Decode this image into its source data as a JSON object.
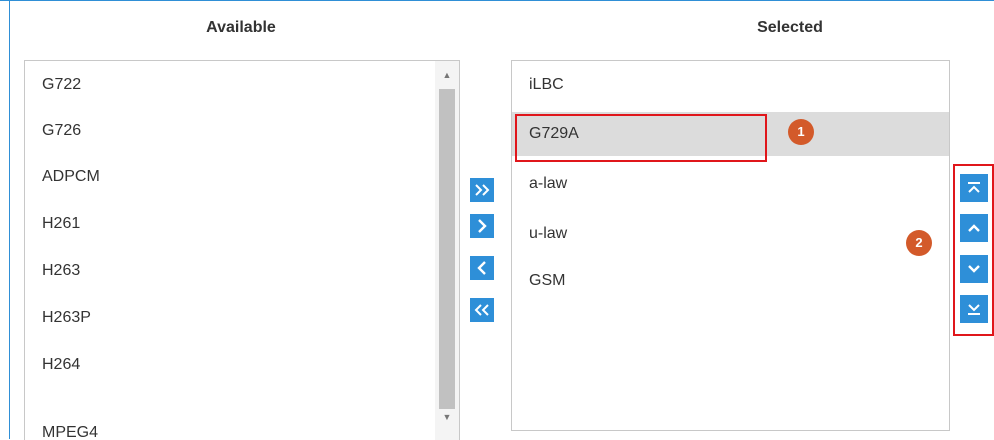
{
  "available": {
    "header": "Available",
    "items": [
      "G722",
      "G726",
      "ADPCM",
      "H261",
      "H263",
      "H263P",
      "H264",
      "MPEG4"
    ]
  },
  "selected": {
    "header": "Selected",
    "items": [
      "iLBC",
      "G729A",
      "a-law",
      "u-law",
      "GSM"
    ],
    "highlighted_item": "G729A"
  },
  "transfer_buttons": [
    "add-all",
    "add-selected",
    "remove-selected",
    "remove-all"
  ],
  "order_buttons": [
    "move-to-top",
    "move-up",
    "move-down",
    "move-to-bottom"
  ],
  "annotations": {
    "marker1": "1",
    "marker2": "2"
  },
  "colors": {
    "accent": "#2e8fd8",
    "marker": "#d35a2a",
    "highlight_border": "#e0161b",
    "selected_row": "#dcdcdc"
  }
}
